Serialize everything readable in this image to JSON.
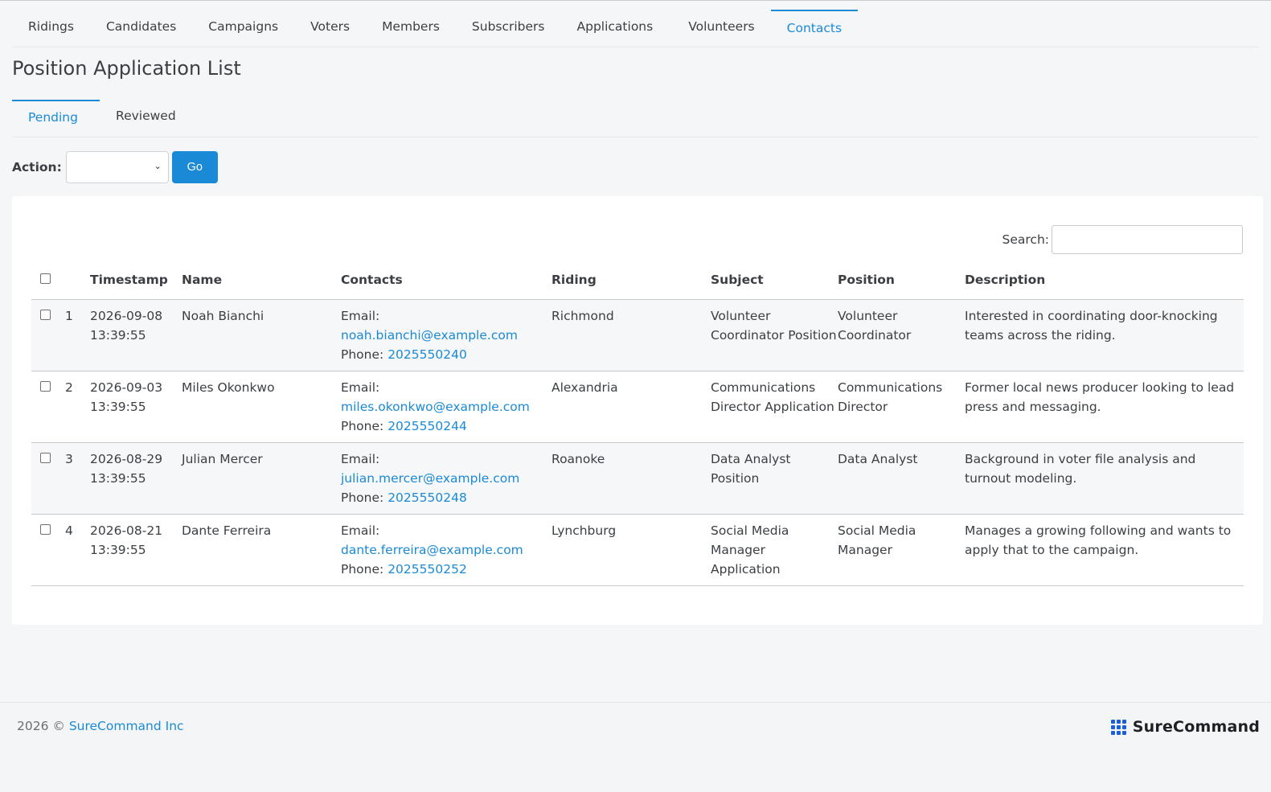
{
  "nav": {
    "tabs": [
      "Ridings",
      "Candidates",
      "Campaigns",
      "Voters",
      "Members",
      "Subscribers",
      "Applications",
      "Volunteers",
      "Contacts"
    ],
    "active": "Contacts"
  },
  "page": {
    "title": "Position Application List"
  },
  "subtabs": {
    "pending": "Pending",
    "reviewed": "Reviewed"
  },
  "actions": {
    "label": "Action:",
    "selected": "",
    "go_label": "Go"
  },
  "search": {
    "label": "Search:",
    "value": ""
  },
  "table": {
    "headers": {
      "timestamp": "Timestamp",
      "name": "Name",
      "contacts": "Contacts",
      "riding": "Riding",
      "subject": "Subject",
      "position": "Position",
      "description": "Description"
    },
    "email_label": "Email:",
    "phone_label": "Phone:",
    "rows": [
      {
        "num": "1",
        "date": "2026-09-08",
        "time": "13:39:55",
        "name": "Noah Bianchi",
        "email": "noah.bianchi@example.com",
        "phone": "2025550240",
        "riding": "Richmond",
        "subject": "Volunteer Coordinator Position",
        "position": "Volunteer Coordinator",
        "description": "Interested in coordinating door-knocking teams across the riding."
      },
      {
        "num": "2",
        "date": "2026-09-03",
        "time": "13:39:55",
        "name": "Miles Okonkwo",
        "email": "miles.okonkwo@example.com",
        "phone": "2025550244",
        "riding": "Alexandria",
        "subject": "Communications Director Application",
        "position": "Communications Director",
        "description": "Former local news producer looking to lead press and messaging."
      },
      {
        "num": "3",
        "date": "2026-08-29",
        "time": "13:39:55",
        "name": "Julian Mercer",
        "email": "julian.mercer@example.com",
        "phone": "2025550248",
        "riding": "Roanoke",
        "subject": "Data Analyst Position",
        "position": "Data Analyst",
        "description": "Background in voter file analysis and turnout modeling."
      },
      {
        "num": "4",
        "date": "2026-08-21",
        "time": "13:39:55",
        "name": "Dante Ferreira",
        "email": "dante.ferreira@example.com",
        "phone": "2025550252",
        "riding": "Lynchburg",
        "subject": "Social Media Manager Application",
        "position": "Social Media Manager",
        "description": "Manages a growing following and wants to apply that to the campaign."
      }
    ]
  },
  "footer": {
    "year_text": "2026 ©",
    "company": "SureCommand Inc",
    "brand": "SureCommand"
  },
  "colors": {
    "accent": "#1b8ad6",
    "brand_logo": "#1a5fd6"
  }
}
